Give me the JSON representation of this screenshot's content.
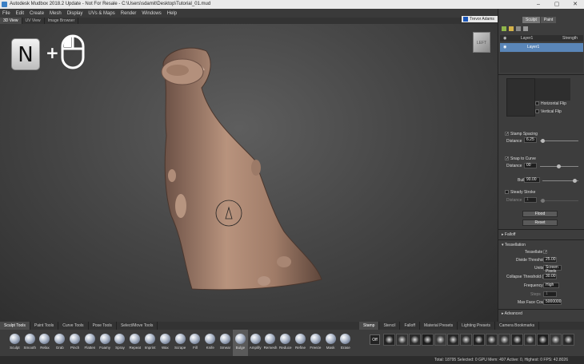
{
  "window": {
    "title": "Autodesk Mudbox 2018.2 Update - Not For Resale - C:\\Users\\sdamit\\Desktop\\Tutorial_01.mud"
  },
  "menu": [
    "File",
    "Edit",
    "Create",
    "Mesh",
    "Display",
    "UVs & Maps",
    "Render",
    "Windows",
    "Help"
  ],
  "user": {
    "name": "Trevor Adams",
    "help": "?"
  },
  "viewport_tabs": [
    {
      "label": "3D View",
      "active": true
    },
    {
      "label": "UV View",
      "active": false
    },
    {
      "label": "Image Browser",
      "active": false
    }
  ],
  "overlay": {
    "key": "N",
    "plus": "+"
  },
  "viewcube": {
    "label": "LEFT"
  },
  "right_tabs": [
    {
      "label": "Sculpt",
      "active": true
    },
    {
      "label": "Paint",
      "active": false
    }
  ],
  "layers": {
    "header_name": "Layer1",
    "header_strength": "Strength",
    "row_name": "Layer1"
  },
  "properties": {
    "horizontal_flip": "Horizontal Flip",
    "vertical_flip": "Vertical Flip",
    "stamp_spacing": "Stamp Spacing",
    "distance_label": "Distance",
    "stamp_distance": "6.25",
    "snap_to_curve": "Snap to Curve",
    "snap_distance": "00",
    "buildup_label": "Buildup",
    "buildup_value": "90.00",
    "steady_stroke": "Steady Stroke",
    "steady_distance": "1",
    "flood": "Flood",
    "reset": "Reset",
    "falloff": "Falloff",
    "tessellation": "Tessellation",
    "tessellate": "Tessellate",
    "divide_threshold_label": "Divide Threshold",
    "divide_threshold": "25.00",
    "units_label": "Units",
    "units": "Screen Pixels",
    "collapse_threshold_label": "Collapse Threshold (%)",
    "collapse_threshold": "30.00",
    "frequency_label": "Frequency",
    "frequency": "High",
    "steps_label": "Steps",
    "steps": "1",
    "max_face_label": "Max Face Count",
    "max_face": "5000000",
    "advanced": "Advanced"
  },
  "tray_tabs": [
    {
      "label": "Sculpt Tools",
      "active": true
    },
    {
      "label": "Paint Tools",
      "active": false
    },
    {
      "label": "Curve Tools",
      "active": false
    },
    {
      "label": "Pose Tools",
      "active": false
    },
    {
      "label": "Select/Move Tools",
      "active": false
    }
  ],
  "tools": [
    "Sculpt",
    "Smooth",
    "Relax",
    "Grab",
    "Pinch",
    "Flatten",
    "Foamy",
    "Spray",
    "Repeat",
    "Imprint",
    "Wax",
    "Scrape",
    "Fill",
    "Knife",
    "Smear",
    "Bulge",
    "Amplify",
    "Remesh",
    "Reduce",
    "Refine",
    "Freeze",
    "Mask",
    "Erase"
  ],
  "active_tool": "Bulge",
  "stamp_tabs": [
    {
      "label": "Stamp",
      "active": true
    },
    {
      "label": "Stencil",
      "active": false
    },
    {
      "label": "Falloff",
      "active": false
    },
    {
      "label": "Material Presets",
      "active": false
    },
    {
      "label": "Lighting Presets",
      "active": false
    },
    {
      "label": "Camera Bookmarks",
      "active": false
    }
  ],
  "stamp_off": "Off",
  "status": "Total: 18795  Selected: 0 GPU Mem: 497  Active: 0, Highest: 0  FPS: 42.8026",
  "colors": {
    "accent": "#5a86b8",
    "mesh": "#a5826e",
    "user_swatch": "#1a56b8"
  }
}
